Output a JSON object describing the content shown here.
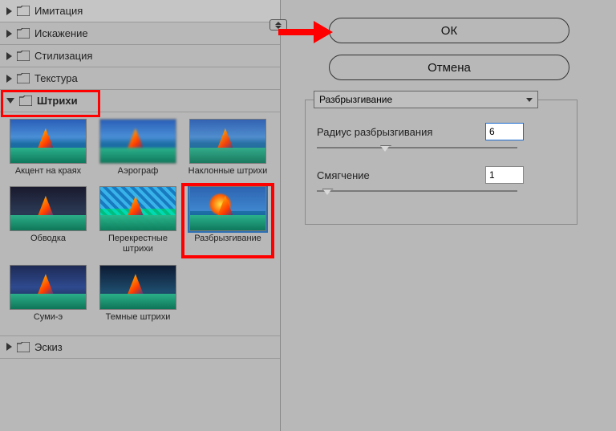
{
  "categories": [
    {
      "label": "Имитация",
      "expanded": false
    },
    {
      "label": "Искажение",
      "expanded": false
    },
    {
      "label": "Стилизация",
      "expanded": false
    },
    {
      "label": "Текстура",
      "expanded": false
    },
    {
      "label": "Штрихи",
      "expanded": true
    },
    {
      "label": "Эскиз",
      "expanded": false
    }
  ],
  "strokes_thumbs": [
    {
      "label": "Акцент на краях"
    },
    {
      "label": "Аэрограф"
    },
    {
      "label": "Наклонные штрихи"
    },
    {
      "label": "Обводка"
    },
    {
      "label": "Перекрестные штрихи"
    },
    {
      "label": "Разбрызгивание",
      "selected": true
    },
    {
      "label": "Суми-э"
    },
    {
      "label": "Темные штрихи"
    }
  ],
  "buttons": {
    "ok": "ОК",
    "cancel": "Отмена"
  },
  "settings": {
    "filter_name": "Разбрызгивание",
    "params": [
      {
        "label": "Радиус разбрызгивания",
        "value": "6",
        "pos_pct": 34
      },
      {
        "label": "Смягчение",
        "value": "1",
        "pos_pct": 5
      }
    ]
  }
}
